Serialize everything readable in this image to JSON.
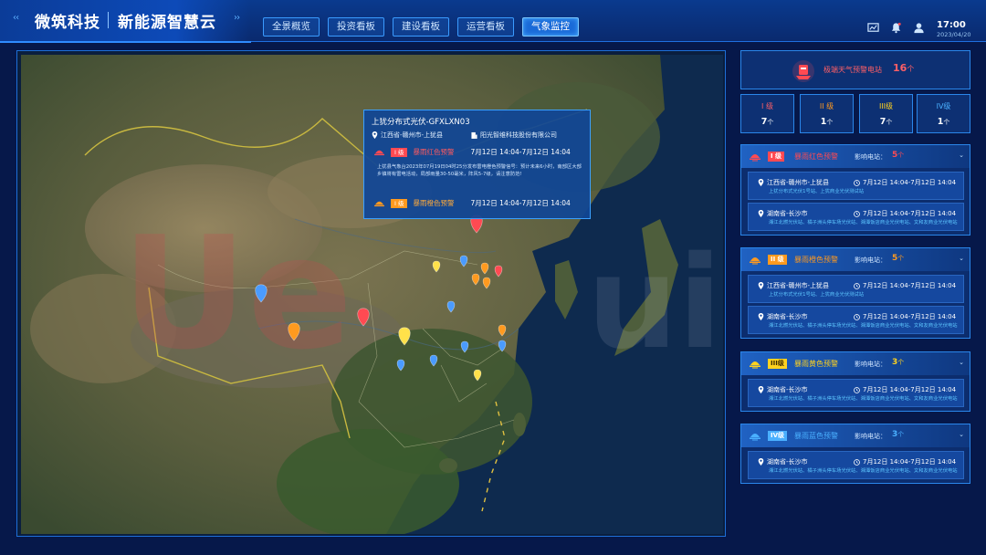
{
  "header": {
    "brand": "微筑科技",
    "subtitle": "新能源智慧云",
    "nav": [
      "全景概览",
      "投资看板",
      "建设看板",
      "运营看板",
      "气象监控"
    ],
    "active_nav": 4,
    "time": "17:00",
    "date": "2023/04/20",
    "icons": [
      "monitor-chart-icon",
      "bell-icon",
      "user-icon"
    ]
  },
  "popup": {
    "title": "上犹分布式光伏-GFXLXN03",
    "location": "江西省-赣州市-上犹县",
    "org": "阳光智维科技股份有限公司",
    "warnings": [
      {
        "level": "I 级",
        "name": "暴雨红色预警",
        "time": "7月12日 14:04-7月12日 14:04",
        "color": "#ff4a52"
      },
      {
        "level": "I 级",
        "name": "暴雨橙色预警",
        "time": "7月12日 14:04-7月12日 14:04",
        "color": "#ff9a1f"
      }
    ],
    "description": "上犹县气象台2023年07月19日04时25分发布雷电橙色预警信号：预计未来6小时，南部区大部乡镇将有雷电活动，局部雨量30-50毫米，阵风5-7级，请注意防范!"
  },
  "summary": {
    "label": "极端天气预警电站",
    "count": "16",
    "unit": "个"
  },
  "levels": [
    {
      "label": "I 级",
      "count": "7",
      "unit": "个",
      "color": "#ff5f66"
    },
    {
      "label": "II 级",
      "count": "1",
      "unit": "个",
      "color": "#ff9a1f"
    },
    {
      "label": "III级",
      "count": "7",
      "unit": "个",
      "color": "#ffd21f"
    },
    {
      "label": "IV级",
      "count": "1",
      "unit": "个",
      "color": "#4ab0ff"
    }
  ],
  "sections": [
    {
      "badge": "I 级",
      "title": "暴雨红色预警",
      "impact": "影响电站：",
      "count": "5",
      "unit": "个",
      "color": "#ff4a52",
      "stations": [
        {
          "location": "江西省-赣州市-上犹县",
          "time": "7月12日 14:04-7月12日 14:04",
          "desc": "上犹分布式光伏1号站、上犹商业光伏测试站"
        },
        {
          "location": "湖南省-长沙市",
          "time": "7月12日 14:04-7月12日 14:04",
          "desc": "湘江北燃光伏站、橘子洲头停车场光伏站、湘潭饭店商业光伏电站、文和友商业光伏电站"
        }
      ]
    },
    {
      "badge": "II 级",
      "title": "暴雨橙色预警",
      "impact": "影响电站：",
      "count": "5",
      "unit": "个",
      "color": "#ff9a1f",
      "stations": [
        {
          "location": "江西省-赣州市-上犹县",
          "time": "7月12日 14:04-7月12日 14:04",
          "desc": "上犹分布式光伏1号站、上犹商业光伏测试站"
        },
        {
          "location": "湖南省-长沙市",
          "time": "7月12日 14:04-7月12日 14:04",
          "desc": "湘江北燃光伏站、橘子洲头停车场光伏站、湘潭饭店商业光伏电站、文和友商业光伏电站"
        }
      ]
    },
    {
      "badge": "III级",
      "title": "暴雨黄色预警",
      "impact": "影响电站：",
      "count": "3",
      "unit": "个",
      "color": "#ffd21f",
      "stations": [
        {
          "location": "湖南省-长沙市",
          "time": "7月12日 14:04-7月12日 14:04",
          "desc": "湘江北燃光伏站、橘子洲头停车场光伏站、湘潭饭店商业光伏电站、文和友商业光伏电站"
        }
      ]
    },
    {
      "badge": "IV级",
      "title": "暴雨蓝色预警",
      "impact": "影响电站：",
      "count": "3",
      "unit": "个",
      "color": "#4ab0ff",
      "stations": [
        {
          "location": "湖南省-长沙市",
          "time": "7月12日 14:04-7月12日 14:04",
          "desc": "湘江北燃光伏站、橘子洲头停车场光伏站、湘潭饭店商业光伏电站、文和友商业光伏电站"
        }
      ]
    }
  ],
  "map_markers": [
    {
      "color": "#ff4a52",
      "size": "large"
    },
    {
      "color": "#4a9bff",
      "size": "large"
    },
    {
      "color": "#ff9a1f",
      "size": "large"
    },
    {
      "color": "#ff4a52",
      "size": "large"
    },
    {
      "color": "#ffe14a",
      "size": "large"
    },
    {
      "color": "#ffe14a",
      "size": "small"
    },
    {
      "color": "#4a9bff",
      "size": "small"
    },
    {
      "color": "#ff9a1f",
      "size": "small"
    },
    {
      "color": "#ff4a52",
      "size": "small"
    },
    {
      "color": "#ff9a1f",
      "size": "small"
    },
    {
      "color": "#ff9a1f",
      "size": "small"
    },
    {
      "color": "#4a9bff",
      "size": "small"
    },
    {
      "color": "#4a9bff",
      "size": "small"
    },
    {
      "color": "#ff9a1f",
      "size": "small"
    },
    {
      "color": "#4a9bff",
      "size": "small"
    },
    {
      "color": "#4a9bff",
      "size": "small"
    },
    {
      "color": "#4a9bff",
      "size": "small"
    },
    {
      "color": "#ffe14a",
      "size": "small"
    }
  ]
}
